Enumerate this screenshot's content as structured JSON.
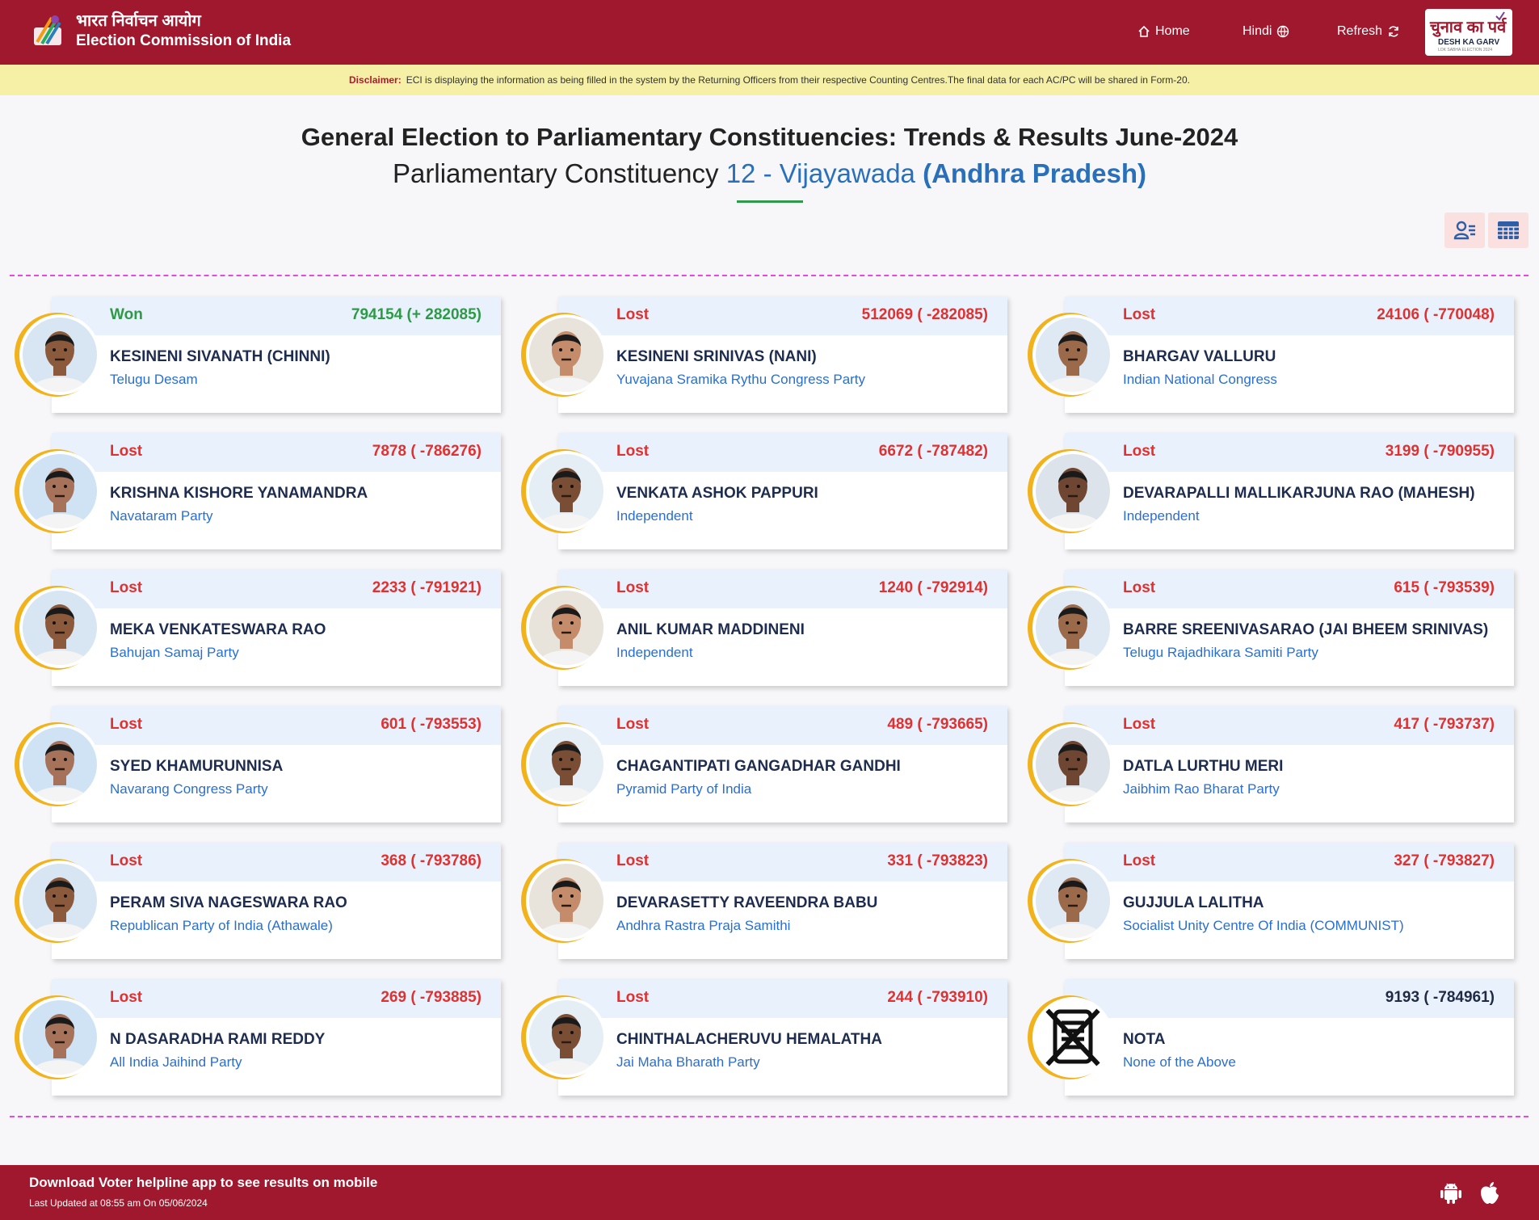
{
  "header": {
    "brand_hindi": "भारत निर्वाचन आयोग",
    "brand_english": "Election Commission of India",
    "nav": {
      "home": "Home",
      "hindi": "Hindi",
      "refresh": "Refresh"
    },
    "badge": {
      "hindi": "चुनाव का पर्व",
      "english": "DESH KA GARV",
      "small": "LOK SABHA ELECTION 2024"
    }
  },
  "disclaimer": {
    "label": "Disclaimer:",
    "text": "ECI is displaying the information as being filled in the system by the Returning Officers from their respective Counting Centres.The final data for each AC/PC will be shared in Form-20."
  },
  "title": {
    "line1": "General Election to Parliamentary Constituencies: Trends & Results June-2024",
    "line2_prefix": "Parliamentary Constituency ",
    "constituency": "12 - Vijayawada",
    "state": "(Andhra Pradesh)"
  },
  "colors": {
    "brand": "#a0182d",
    "won": "#2e9a48",
    "lost": "#e03131",
    "party": "#2a6fd0",
    "accent_ring": "#f2b21b"
  },
  "candidates": [
    {
      "status": "Won",
      "votes": "794154 (+ 282085)",
      "name": "KESINENI SIVANATH (CHINNI)",
      "party": "Telugu Desam"
    },
    {
      "status": "Lost",
      "votes": "512069 ( -282085)",
      "name": "KESINENI SRINIVAS (NANI)",
      "party": "Yuvajana Sramika Rythu Congress Party"
    },
    {
      "status": "Lost",
      "votes": "24106 ( -770048)",
      "name": "BHARGAV VALLURU",
      "party": "Indian National Congress"
    },
    {
      "status": "Lost",
      "votes": "7878 ( -786276)",
      "name": "KRISHNA KISHORE YANAMANDRA",
      "party": "Navataram Party"
    },
    {
      "status": "Lost",
      "votes": "6672 ( -787482)",
      "name": "VENKATA ASHOK PAPPURI",
      "party": "Independent"
    },
    {
      "status": "Lost",
      "votes": "3199 ( -790955)",
      "name": "DEVARAPALLI MALLIKARJUNA RAO (MAHESH)",
      "party": "Independent"
    },
    {
      "status": "Lost",
      "votes": "2233 ( -791921)",
      "name": "MEKA VENKATESWARA RAO",
      "party": "Bahujan Samaj Party"
    },
    {
      "status": "Lost",
      "votes": "1240 ( -792914)",
      "name": "ANIL KUMAR MADDINENI",
      "party": "Independent"
    },
    {
      "status": "Lost",
      "votes": "615 ( -793539)",
      "name": "BARRE SREENIVASARAO (JAI BHEEM SRINIVAS)",
      "party": "Telugu Rajadhikara Samiti Party"
    },
    {
      "status": "Lost",
      "votes": "601 ( -793553)",
      "name": "SYED KHAMURUNNISA",
      "party": "Navarang Congress Party"
    },
    {
      "status": "Lost",
      "votes": "489 ( -793665)",
      "name": "CHAGANTIPATI GANGADHAR GANDHI",
      "party": "Pyramid Party of India"
    },
    {
      "status": "Lost",
      "votes": "417 ( -793737)",
      "name": "DATLA LURTHU MERI",
      "party": "Jaibhim Rao Bharat Party"
    },
    {
      "status": "Lost",
      "votes": "368 ( -793786)",
      "name": "PERAM SIVA NAGESWARA RAO",
      "party": "Republican Party of India (Athawale)"
    },
    {
      "status": "Lost",
      "votes": "331 ( -793823)",
      "name": "DEVARASETTY RAVEENDRA BABU",
      "party": "Andhra Rastra Praja Samithi"
    },
    {
      "status": "Lost",
      "votes": "327 ( -793827)",
      "name": "GUJJULA LALITHA",
      "party": "Socialist Unity Centre Of India (COMMUNIST)"
    },
    {
      "status": "Lost",
      "votes": "269 ( -793885)",
      "name": "N DASARADHA RAMI REDDY",
      "party": "All India Jaihind Party"
    },
    {
      "status": "Lost",
      "votes": "244 ( -793910)",
      "name": "CHINTHALACHERUVU HEMALATHA",
      "party": "Jai Maha Bharath Party"
    },
    {
      "status": "",
      "votes": "9193 ( -784961)",
      "name": "NOTA",
      "party": "None of the Above"
    }
  ],
  "footer": {
    "download_text": "Download Voter helpline app to see results on mobile",
    "last_updated": "Last Updated at 08:55 am On 05/06/2024"
  }
}
